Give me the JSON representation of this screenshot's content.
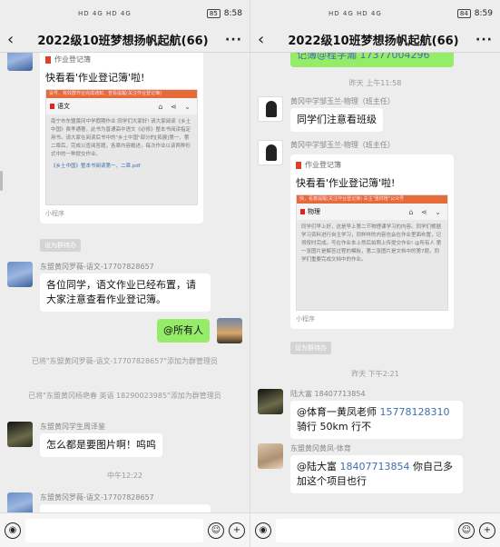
{
  "status": {
    "left_icons": "HD 4G HD 4G",
    "left": {
      "battery": "85",
      "time": "8:58"
    },
    "right": {
      "battery": "84",
      "time": "8:59"
    }
  },
  "chat": {
    "title": "2022级10班梦想扬帆起航(66)"
  },
  "icons": {
    "back": "‹",
    "more": "···",
    "voice": "◉",
    "emoji": "☺",
    "plus": "+",
    "share_icons": "⌂ ⋖ ⌄"
  },
  "left": {
    "card": {
      "source": "作业登记簿",
      "title": "快看看'作业登记簿'啦!",
      "banner": "设号、有效群作业完成通知、查看提醒(关注作业登记簿)",
      "subject": "语文",
      "body": "南宁市东盟黄冈中学假期作业 同学们大家好! 请大家阅读《乡土中国》费孝通著，此书为普通高中语文《必修》整本书阅读指定用书。请大家在阅读后书中的\"乡土中国\"部分的[拓展]第一、第二章后，完成以查阅答题，各章内容概述，每次作业以该两种形式中的一种提交作业。",
      "doc_link": "《乡土中国》整本书阅读第一、二章.pdf",
      "footer": "小程序",
      "tag": "设为群待办"
    },
    "msg1": {
      "sender": "东盟黄冈罗薇-语文-17707828657",
      "text": "各位同学，语文作业已经布置，请大家注意查看作业登记簿。"
    },
    "msg2": {
      "text": "@所有人"
    },
    "sys1": "已将\"东盟黄冈罗薇-语文-17707828657\"添加为群管理员",
    "sys2": "已将\"东盟黄冈杨艳春 英语 18290023985\"添加为群管理员",
    "msg3": {
      "sender": "东盟黄冈学生周泽鉴",
      "text": "怎么都是要图片啊！呜呜"
    },
    "time1": "中午12:22",
    "msg4": {
      "sender": "东盟黄冈罗薇-语文-17707828657"
    }
  },
  "right": {
    "top_fragment": "记簿@程学瀚 17377004296",
    "time1": "昨天 上午11:58",
    "msg1": {
      "sender": "黄冈中学邹玉兰-物理（班主任）",
      "text": "同学们注意看班级"
    },
    "msg2": {
      "sender": "黄冈中学邹玉兰-物理（班主任）"
    },
    "card": {
      "source": "作业登记簿",
      "title": "快看看'作业登记簿'啦!",
      "banner": "快，看着提醒(关注作业登记簿)     关注\"重样橙\"公众号",
      "subject": "物理",
      "body": "同学们早上好，这是早上第二节物理课学习的内容。同学们根据学习资料进行自主学习，同样样的内容也会在作业里面布置，记得按时完成。写在作业本上然后拍照上传提交作业! @所有人  第一张图片是解答过程的模板，第二张图片是文档中的第7题，同学们重要完成文档中的作业。",
      "footer": "小程序",
      "tag": "设为群待办"
    },
    "time2": "昨天 下午2:21",
    "msg3": {
      "sender": "陆大富 18407713854",
      "text_pre": "@体育一黄凤老师 ",
      "phone": "15778128310",
      "text_post": "骑行 50km 行不"
    },
    "msg4": {
      "sender": "东盟黄冈黄凤-体育",
      "text_pre": "@陆大富 ",
      "phone": "18407713854",
      "text_post": " 你自己多加这个项目也行"
    }
  }
}
